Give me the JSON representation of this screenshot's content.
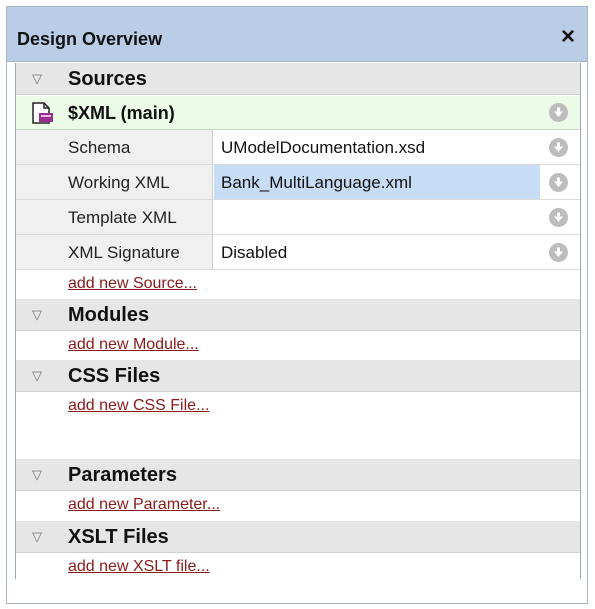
{
  "panel": {
    "title": "Design Overview",
    "close_label": "×"
  },
  "sections": [
    {
      "name": "Sources",
      "add_link": "add new Source..."
    },
    {
      "name": "Modules",
      "add_link": "add new Module..."
    },
    {
      "name": "CSS Files",
      "add_link": "add new CSS File..."
    },
    {
      "name": "Parameters",
      "add_link": "add new Parameter..."
    },
    {
      "name": "XSLT Files",
      "add_link": "add new XSLT file..."
    }
  ],
  "source": {
    "name": "$XML (main)",
    "properties": [
      {
        "key": "Schema",
        "value": "UModelDocumentation.xsd"
      },
      {
        "key": "Working XML",
        "value": "Bank_MultiLanguage.xml"
      },
      {
        "key": "Template XML",
        "value": ""
      },
      {
        "key": "XML Signature",
        "value": "Disabled"
      }
    ]
  },
  "colors": {
    "header": "#b9cde7",
    "link": "#8b1a1a",
    "selection": "#c7dcf5",
    "main_source_bg": "#ecfae8"
  },
  "icons": {
    "collapse": "triangle-down-icon",
    "source_file": "xml-file-icon",
    "menu": "circle-down-arrow-icon"
  }
}
